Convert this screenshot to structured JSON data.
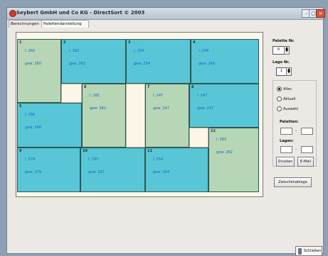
{
  "window": {
    "title": "Seybert GmbH und Co KG - DirectSort © 2003"
  },
  "tabs": [
    {
      "label": "Berechnungen"
    },
    {
      "label": "Palettendarstellung"
    }
  ],
  "cells": [
    {
      "num": "1",
      "line1": "l: 260",
      "line2": "gew: 260",
      "color": "green"
    },
    {
      "num": "2",
      "line1": "l: 262",
      "line2": "gew: 262",
      "color": "blue"
    },
    {
      "num": "3",
      "line1": "l: 254",
      "line2": "gew: 254",
      "color": "blue"
    },
    {
      "num": "4",
      "line1": "l: 249",
      "line2": "gew: 249",
      "color": "blue"
    },
    {
      "num": "5",
      "line1": "l: 266",
      "line2": "gew: 266",
      "color": "blue"
    },
    {
      "num": "6",
      "line1": "l: 281",
      "line2": "gew: 281",
      "color": "green"
    },
    {
      "num": "7",
      "line1": "l: 247",
      "line2": "gew: 247",
      "color": "green"
    },
    {
      "num": "8",
      "line1": "l: 247",
      "line2": "gew: 247",
      "color": "blue"
    },
    {
      "num": "9",
      "line1": "l: 279",
      "line2": "gew: 279",
      "color": "blue"
    },
    {
      "num": "10",
      "line1": "l: 297",
      "line2": "gew: 297",
      "color": "blue"
    },
    {
      "num": "11",
      "line1": "l: 254",
      "line2": "gew: 254",
      "color": "blue"
    },
    {
      "num": "12",
      "line1": "l: 262",
      "line2": "gew: 262",
      "color": "green"
    }
  ],
  "right": {
    "palette_label": "Palette Nr.",
    "palette_value": "0",
    "lage_label": "Lage Nr.",
    "lage_value": "1",
    "radio_alle": "Alles",
    "radio_aktuell": "Aktuell",
    "radio_auswahl": "Auswahl",
    "paletten_label": "Paletten:",
    "lagen_label": "Lagen:",
    "drucken_label": "Drucken",
    "email_label": "E-Mail",
    "zwischenablage_label": "Zwischenablage"
  },
  "footer": {
    "schliessen_label": "Schließen"
  },
  "icons": {
    "app": "app-icon",
    "minimize": "minimize-icon",
    "maximize": "maximize-icon",
    "close": "close-icon",
    "up": "chevron-up-icon",
    "down": "chevron-down-icon",
    "print": "print-icon"
  }
}
